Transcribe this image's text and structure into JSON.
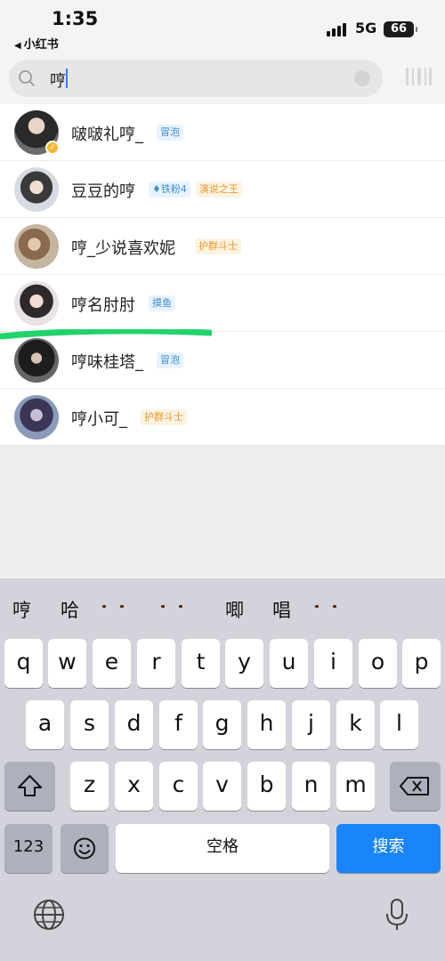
{
  "status_bar": {
    "time": "1:35",
    "back_app": "小红书",
    "network": "5G",
    "battery": "66"
  },
  "search": {
    "query": "哼",
    "clear_icon": "clear-icon",
    "right_button_icon": "scan-icon"
  },
  "results": [
    {
      "name": "啵啵礼哼_",
      "verified": true,
      "badges": [
        {
          "text": "冒泡",
          "style": "blue"
        }
      ]
    },
    {
      "name": "豆豆的哼",
      "verified": false,
      "badges": [
        {
          "text": "♦铁粉4",
          "style": "blue"
        },
        {
          "text": "演说之王",
          "style": "orange"
        }
      ]
    },
    {
      "name": "哼_少说喜欢妮",
      "verified": false,
      "badges": [
        {
          "text": "护群斗士",
          "style": "orange"
        }
      ]
    },
    {
      "name": "哼名肘肘",
      "verified": false,
      "badges": [
        {
          "text": "摸鱼",
          "style": "blue"
        }
      ]
    },
    {
      "name": "哼味桂塔_",
      "verified": false,
      "badges": [
        {
          "text": "冒泡",
          "style": "blue"
        }
      ]
    },
    {
      "name": "哼小可_",
      "verified": false,
      "badges": [
        {
          "text": "护群斗士",
          "style": "orange"
        }
      ]
    }
  ],
  "keyboard": {
    "candidates": [
      "哼",
      "哈",
      "angry-face-emoji",
      "cat-face-emoji",
      "唧",
      "唱",
      "unamused-face-emoji"
    ],
    "candidate_text": [
      "哼",
      "哈",
      "唧",
      "唱"
    ],
    "row1": [
      "q",
      "w",
      "e",
      "r",
      "t",
      "y",
      "u",
      "i",
      "o",
      "p"
    ],
    "row2": [
      "a",
      "s",
      "d",
      "f",
      "g",
      "h",
      "j",
      "k",
      "l"
    ],
    "row3": [
      "z",
      "x",
      "c",
      "v",
      "b",
      "n",
      "m"
    ],
    "numbers_label": "123",
    "space_label": "空格",
    "search_label": "搜索"
  },
  "colors": {
    "accent": "#1a84fb",
    "annotation_green": "#22d36b",
    "badge_blue": "#3e8fd6",
    "badge_orange": "#e79a2e"
  }
}
